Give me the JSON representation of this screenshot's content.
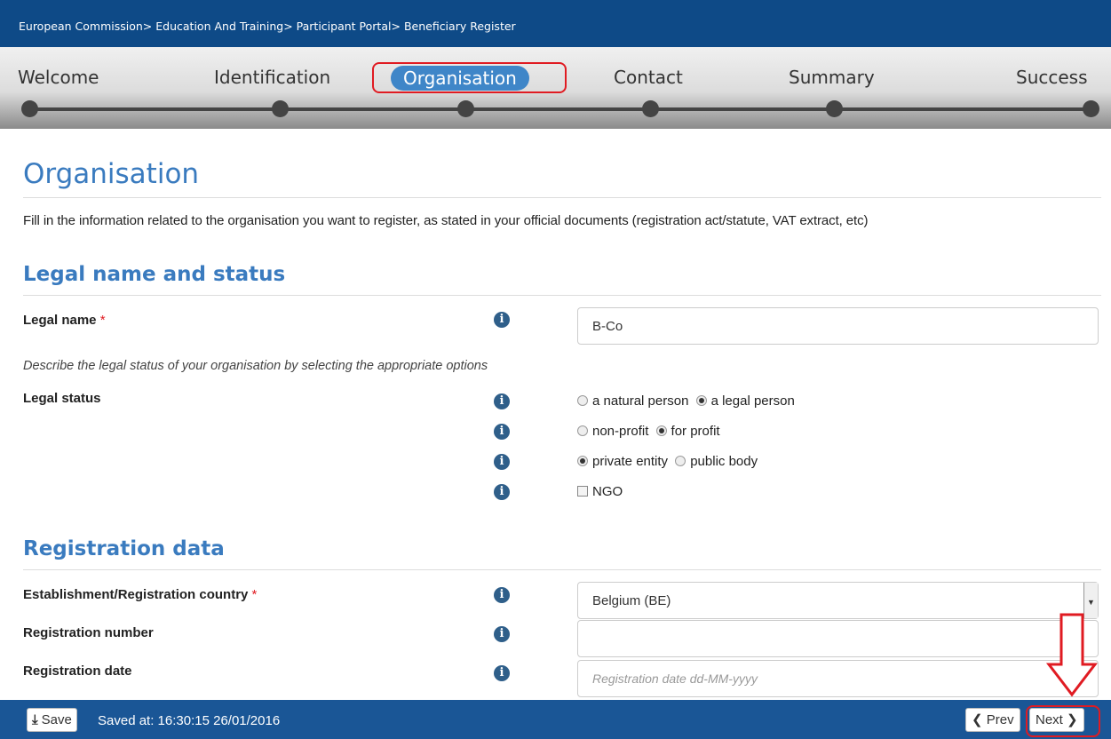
{
  "breadcrumb": [
    "European Commission",
    "Education And Training",
    "Participant Portal",
    "Beneficiary Register"
  ],
  "breadcrumb_sep": ">",
  "wizard": {
    "steps": [
      "Welcome",
      "Identification",
      "Organisation",
      "Contact",
      "Summary",
      "Success"
    ],
    "active": "Organisation"
  },
  "page": {
    "title": "Organisation",
    "intro": "Fill in the information related to the organisation you want to register, as stated in your official documents (registration act/statute, VAT extract, etc)"
  },
  "legal": {
    "title": "Legal name and status",
    "name_label": "Legal name",
    "required_mark": "*",
    "name_value": "B-Co",
    "note": "Describe the legal status of your organisation by selecting the appropriate options",
    "status_label": "Legal status",
    "options": {
      "natural": "a natural person",
      "legal": "a legal person",
      "nonprofit": "non-profit",
      "forprofit": "for profit",
      "private": "private entity",
      "public": "public body",
      "ngo": "NGO"
    }
  },
  "registration": {
    "title": "Registration data",
    "country_label": "Establishment/Registration country",
    "country_value": "Belgium (BE)",
    "number_label": "Registration number",
    "number_value": "",
    "date_label": "Registration date",
    "date_placeholder": "Registration date dd-MM-yyyy"
  },
  "footer": {
    "save_label": "Save",
    "saved_text": "Saved at: 16:30:15 26/01/2016",
    "prev_label": "Prev",
    "next_label": "Next"
  },
  "colors": {
    "header_bg": "#0e4a87",
    "accent": "#3a7bbf",
    "highlight": "#e01b22",
    "footer_bg": "#1a5696"
  },
  "icons": [
    "info-icon",
    "download-icon",
    "chevron-left-icon",
    "chevron-right-icon",
    "arrow-down-icon"
  ]
}
